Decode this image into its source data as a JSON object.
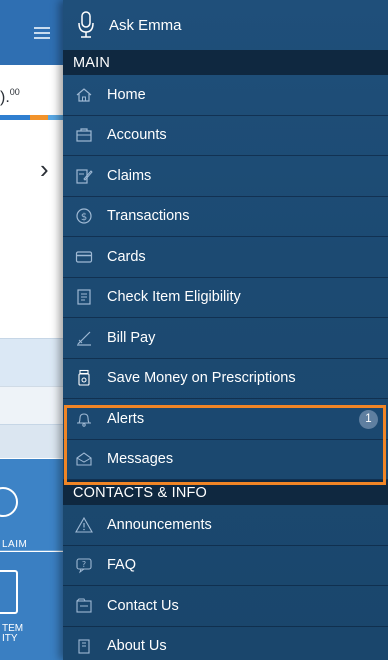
{
  "background_app": {
    "balance_amount": ").",
    "balance_cents": "00",
    "tile1_label": "LAIM",
    "tile2_label_line1": "TEM",
    "tile2_label_line2": "ITY"
  },
  "drawer": {
    "ask": {
      "label": "Ask Emma",
      "icon": "microphone-icon"
    },
    "sections": [
      {
        "title": "MAIN",
        "items": [
          {
            "label": "Home",
            "icon": "home-icon"
          },
          {
            "label": "Accounts",
            "icon": "briefcase-icon"
          },
          {
            "label": "Claims",
            "icon": "claims-edit-icon"
          },
          {
            "label": "Transactions",
            "icon": "dollar-circle-icon"
          },
          {
            "label": "Cards",
            "icon": "card-icon"
          },
          {
            "label": "Check Item Eligibility",
            "icon": "checklist-icon"
          },
          {
            "label": "Bill Pay",
            "icon": "check-sign-icon"
          },
          {
            "label": "Save Money on Prescriptions",
            "icon": "prescription-bottle-icon"
          },
          {
            "label": "Alerts",
            "icon": "bell-icon",
            "badge": "1"
          },
          {
            "label": "Messages",
            "icon": "envelope-icon"
          }
        ]
      },
      {
        "title": "CONTACTS & INFO",
        "items": [
          {
            "label": "Announcements",
            "icon": "warning-icon"
          },
          {
            "label": "FAQ",
            "icon": "chat-question-icon"
          },
          {
            "label": "Contact Us",
            "icon": "contact-card-icon"
          },
          {
            "label": "About Us",
            "icon": "building-icon"
          }
        ]
      }
    ]
  },
  "colors": {
    "drawer_bg": "#1d4b74",
    "section_bg": "#0f2840",
    "highlight": "#f08526",
    "app_blue": "#3d83c6"
  }
}
